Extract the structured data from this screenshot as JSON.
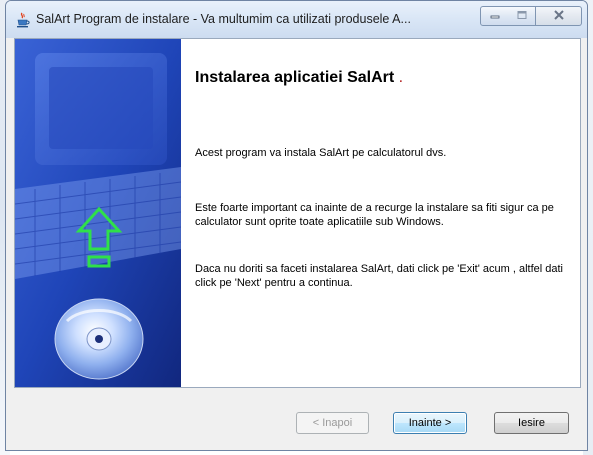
{
  "window": {
    "title": "SalArt Program de instalare - Va multumim ca utilizati produsele A...",
    "icon": "java-cup-icon"
  },
  "heading": {
    "text": "Instalarea aplicatiei  SalArt",
    "suffix": "."
  },
  "paragraphs": {
    "p1": "Acest program va  instala  SalArt pe calculatorul dvs.",
    "p2": "Este foarte important ca inainte de a recurge la instalare sa fiti sigur ca pe calculator sunt oprite toate aplicatiile sub Windows.",
    "p3": "Daca nu doriti sa faceti instalarea  SalArt, dati click pe 'Exit' acum , altfel dati click pe 'Next' pentru a continua."
  },
  "buttons": {
    "back": "< Inapoi",
    "next": "Inainte >",
    "exit": "Iesire"
  },
  "colors": {
    "side_panel": "#1c3fb3",
    "arrow": "#2fe04a",
    "heading_dot": "#b22222",
    "default_button_border": "#3c7fb1"
  }
}
